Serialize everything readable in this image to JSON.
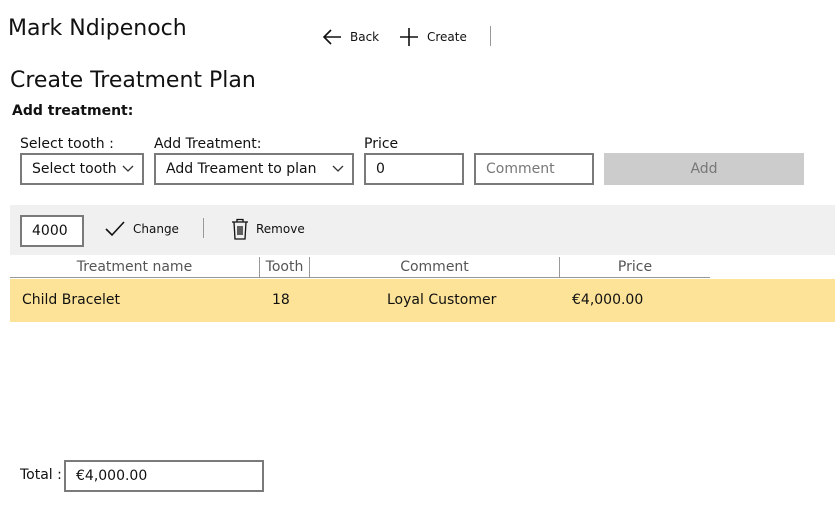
{
  "app": {
    "title": "Mark Ndipenoch"
  },
  "command_bar": {
    "back_label": "Back",
    "create_label": "Create"
  },
  "page": {
    "heading": "Create Treatment Plan",
    "subheading": "Add treatment:"
  },
  "form": {
    "tooth_label": "Select tooth :",
    "tooth_value": "Select tooth",
    "treatment_label": "Add Treatment:",
    "treatment_value": "Add Treament to plan",
    "price_label": "Price",
    "price_value": "0",
    "comment_placeholder": "Comment",
    "add_label": "Add"
  },
  "toolbar": {
    "price_value": "4000",
    "change_label": "Change",
    "remove_label": "Remove"
  },
  "table": {
    "columns": [
      "Treatment name",
      "Tooth",
      "Comment",
      "Price"
    ],
    "rows": [
      {
        "name": "Child Bracelet",
        "tooth": "18",
        "comment": "Loyal Customer",
        "price": "€4,000.00"
      }
    ]
  },
  "footer": {
    "total_label": "Total :",
    "total_value": "€4,000.00"
  },
  "colors": {
    "selected_row": "#fde398",
    "toolbar_bg": "#f0f0f0",
    "disabled_button": "#cccccc"
  }
}
